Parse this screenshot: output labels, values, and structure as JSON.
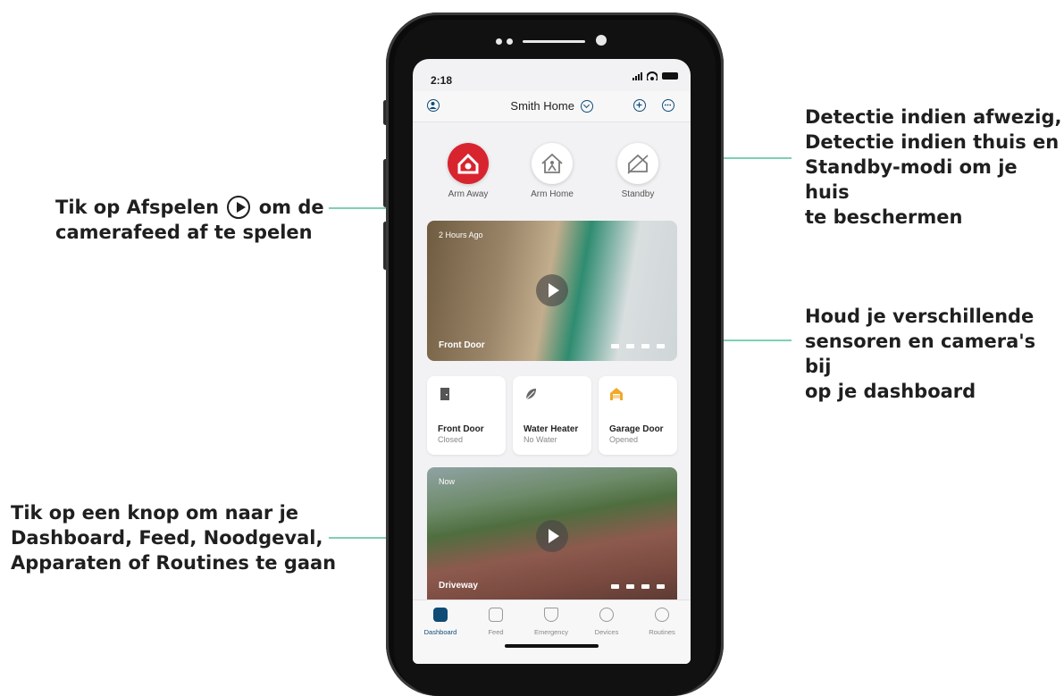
{
  "status_bar": {
    "time": "2:18"
  },
  "header": {
    "home_name": "Smith Home"
  },
  "modes": [
    {
      "label": "Arm Away",
      "icon": "arm-away-icon",
      "active": true
    },
    {
      "label": "Arm Home",
      "icon": "arm-home-icon",
      "active": false
    },
    {
      "label": "Standby",
      "icon": "standby-icon",
      "active": false
    }
  ],
  "cameras": [
    {
      "name": "Front Door",
      "timestamp": "2 Hours Ago"
    },
    {
      "name": "Driveway",
      "timestamp": "Now"
    }
  ],
  "sensors": [
    {
      "name": "Front Door",
      "state": "Closed",
      "icon": "door-icon"
    },
    {
      "name": "Water Heater",
      "state": "No Water",
      "icon": "leaf-icon"
    },
    {
      "name": "Garage Door",
      "state": "Opened",
      "icon": "garage-icon"
    }
  ],
  "tabs": [
    {
      "label": "Dashboard",
      "icon": "home-icon",
      "active": true
    },
    {
      "label": "Feed",
      "icon": "feed-icon",
      "active": false
    },
    {
      "label": "Emergency",
      "icon": "shield-icon",
      "active": false
    },
    {
      "label": "Devices",
      "icon": "devices-icon",
      "active": false
    },
    {
      "label": "Routines",
      "icon": "routines-icon",
      "active": false
    }
  ],
  "callouts": {
    "modes": "Detectie indien afwezig, Detectie indien thuis en Standby-modi om je huis te beschermen",
    "modes_lines": [
      "Detectie indien afwezig,",
      "Detectie indien thuis en",
      "Standby-modi om je huis",
      "te beschermen"
    ],
    "play_before": "Tik op Afspelen",
    "play_after": "om de",
    "play_line2": "camerafeed af te spelen",
    "sensors_lines": [
      "Houd je verschillende",
      "sensoren en camera's bij",
      "op je dashboard"
    ],
    "tabs_lines": [
      "Tik op een knop om naar je",
      "Dashboard, Feed, Noodgeval,",
      "Apparaten of Routines te gaan"
    ]
  },
  "colors": {
    "accent": "#0f4c75",
    "arm_away": "#d8242f",
    "callout_line": "#7fcfb4"
  }
}
